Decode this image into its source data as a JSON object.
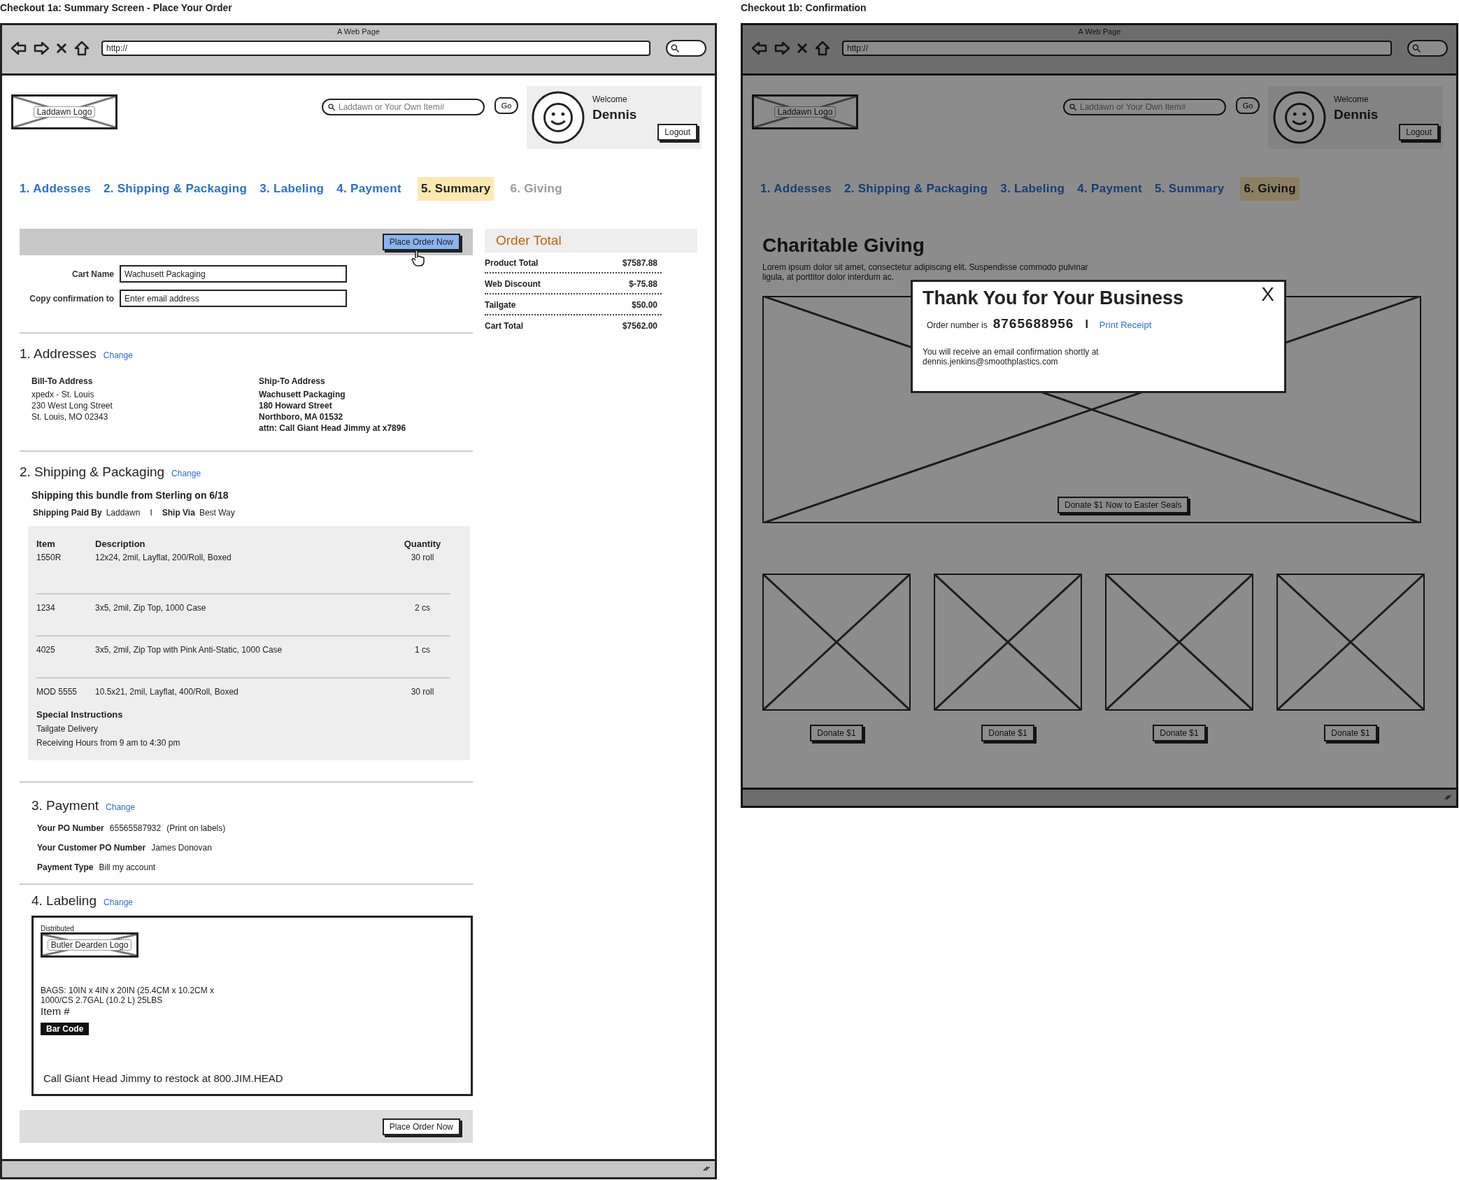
{
  "screens": [
    {
      "kind": "summary",
      "caption": "Checkout 1a: Summary Screen - Place Your Order",
      "dimmed": false,
      "browser": {
        "title": "A Web Page",
        "url": "http://"
      },
      "header": {
        "logo": "Laddawn Logo",
        "search_placeholder": "Laddawn or Your Own Item#",
        "go": "Go",
        "welcome": "Welcome",
        "user": "Dennis",
        "logout": "Logout"
      },
      "steps": [
        {
          "label": "1. Addesses",
          "selected": false,
          "disabled": false
        },
        {
          "label": "2. Shipping & Packaging",
          "selected": false,
          "disabled": false
        },
        {
          "label": "3. Labeling",
          "selected": false,
          "disabled": false
        },
        {
          "label": "4. Payment",
          "selected": false,
          "disabled": false
        },
        {
          "label": "5. Summary",
          "selected": true,
          "disabled": false
        },
        {
          "label": "6. Giving",
          "selected": false,
          "disabled": true
        }
      ],
      "top_action": {
        "label": "Place Order Now",
        "highlighted": true
      },
      "cart_fields": [
        {
          "label": "Cart Name",
          "value": "Wachusett Packaging"
        },
        {
          "label": "Copy confirmation to",
          "placeholder": "Enter email address"
        }
      ],
      "order_total": {
        "title": "Order Total",
        "rows": [
          {
            "label": "Product Total",
            "value": "$7587.88"
          },
          {
            "label": "Web Discount",
            "value": "$-75.88"
          },
          {
            "label": "Tailgate",
            "value": "$50.00"
          },
          {
            "label": "Cart Total",
            "value": "$7562.00"
          }
        ]
      },
      "addresses": {
        "title": "1. Addresses",
        "change": "Change",
        "bill_to": {
          "heading": "Bill-To Address",
          "lines": [
            "xpedx - St. Louis",
            "230 West Long Street",
            "St. Louis, MO 02343"
          ]
        },
        "ship_to": {
          "heading": "Ship-To Address",
          "lines": [
            "Wachusett Packaging",
            "180 Howard Street",
            "Northboro, MA 01532",
            "attn: Call Giant Head Jimmy at x7896"
          ]
        }
      },
      "shipping": {
        "title": "2. Shipping & Packaging",
        "change": "Change",
        "bundle": "Shipping this bundle from Sterling on 6/18",
        "terms": [
          {
            "label": "Shipping Paid By",
            "value": "Laddawn"
          },
          {
            "label": "Ship Via",
            "value": "Best Way"
          }
        ],
        "separator": "I",
        "table": {
          "columns": [
            "Item",
            "Description",
            "Quantity"
          ],
          "rows": [
            [
              "1550R",
              "12x24, 2mil, Layflat, 200/Roll, Boxed",
              "30 roll"
            ],
            [
              "1234",
              "3x5, 2mil, Zip Top, 1000 Case",
              "2 cs"
            ],
            [
              "4025",
              "3x5, 2mil, Zip Top with Pink Anti-Static, 1000 Case",
              "1 cs"
            ],
            [
              "MOD 5555",
              "10.5x21, 2mil, Layflat, 400/Roll, Boxed",
              "30 roll"
            ]
          ]
        },
        "instructions": {
          "heading": "Special Instructions",
          "lines": [
            "Tailgate Delivery",
            "Receiving Hours from 9 am to 4:30 pm"
          ]
        }
      },
      "payment": {
        "title": "3. Payment",
        "change": "Change",
        "fields": [
          {
            "label": "Your PO Number",
            "value": "65565587932",
            "note": "(Print on labels)"
          },
          {
            "label": "Your Customer PO Number",
            "value": "James Donovan"
          },
          {
            "label": "Payment Type",
            "value": "Bill my account"
          }
        ]
      },
      "labeling": {
        "title": "4. Labeling",
        "change": "Change",
        "distributed": "Distributed",
        "logo": "Butler Dearden Logo",
        "bags": [
          "BAGS: 10IN x 4IN x 20IN (25.4CM x 10.2CM x",
          "1000/CS 2.7GAL (10.2 L) 25LBS"
        ],
        "item": "Item #",
        "barcode": "Bar Code",
        "restock": "Call Giant Head Jimmy to restock at 800.JIM.HEAD"
      },
      "bottom_action": {
        "label": "Place Order Now",
        "highlighted": false
      }
    },
    {
      "kind": "confirmation",
      "caption": "Checkout 1b: Confirmation",
      "dimmed": true,
      "browser": {
        "title": "A Web Page",
        "url": "http://"
      },
      "header": {
        "logo": "Laddawn Logo",
        "search_placeholder": "Laddawn or Your Own Item#",
        "go": "Go",
        "welcome": "Welcome",
        "user": "Dennis",
        "logout": "Logout"
      },
      "steps": [
        {
          "label": "1. Addesses",
          "selected": false,
          "disabled": false
        },
        {
          "label": "2. Shipping & Packaging",
          "selected": false,
          "disabled": false
        },
        {
          "label": "3. Labeling",
          "selected": false,
          "disabled": false
        },
        {
          "label": "4. Payment",
          "selected": false,
          "disabled": false
        },
        {
          "label": "5. Summary",
          "selected": false,
          "disabled": false
        },
        {
          "label": "6. Giving",
          "selected": true,
          "disabled": false
        }
      ],
      "heading": "Charitable Giving",
      "lorem": [
        "Lorem ipsum dolor sit amet, consectetur adipiscing elit. Suspendisse commodo pulvinar",
        "ligula, at porttitor dolor interdum ac."
      ],
      "feature_donate": "Donate $1 Now to Easter Seals",
      "donations": [
        "Donate $1",
        "Donate $1",
        "Donate $1",
        "Donate $1"
      ],
      "modal": {
        "title": "Thank You for Your Business",
        "close": "X",
        "order_label": "Order number is",
        "order_number": "8765688956",
        "separator": "I",
        "print_link": "Print Receipt",
        "message": [
          "You will receive an email confirmation shortly at",
          "dennis.jenkins@smoothplastics.com"
        ]
      }
    }
  ]
}
